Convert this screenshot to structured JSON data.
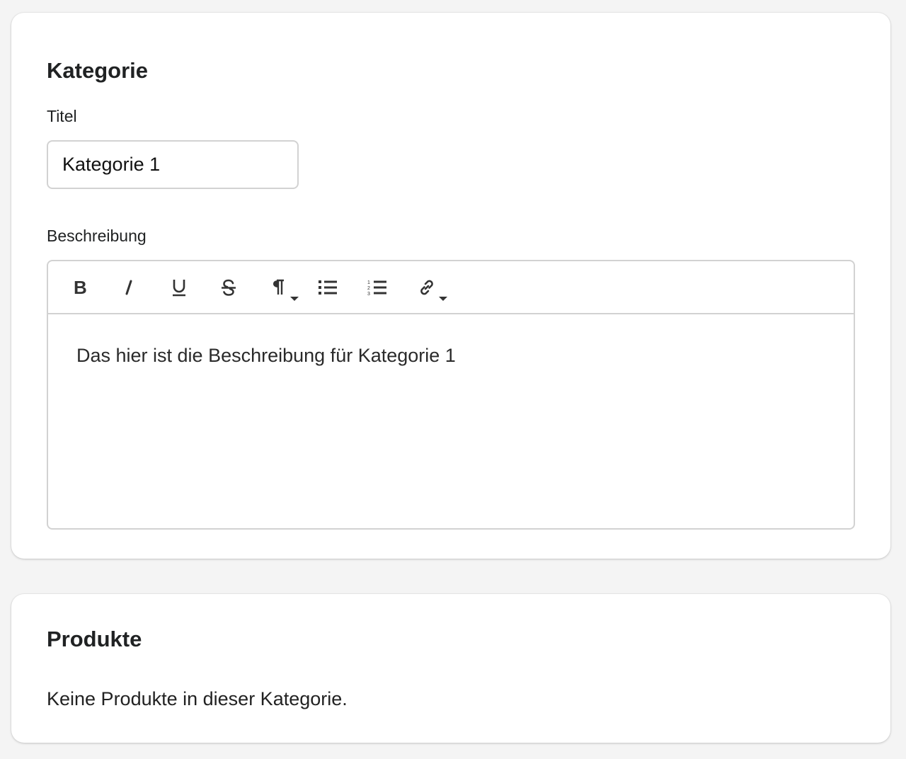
{
  "category_card": {
    "title": "Kategorie",
    "title_label": "Titel",
    "title_value": "Kategorie 1",
    "description_label": "Beschreibung",
    "description_text": "Das hier ist die Beschreibung für Kategorie 1",
    "toolbar": {
      "bold_icon": "bold-icon",
      "italic_icon": "italic-icon",
      "underline_icon": "underline-icon",
      "strikethrough_icon": "strikethrough-icon",
      "paragraph_icon": "paragraph-icon",
      "bullet_list_icon": "bullet-list-icon",
      "numbered_list_icon": "numbered-list-icon",
      "link_icon": "link-icon"
    }
  },
  "products_card": {
    "title": "Produkte",
    "empty_text": "Keine Produkte in dieser Kategorie."
  },
  "colors": {
    "background": "#f4f4f4",
    "card": "#ffffff",
    "border": "#d2d2d2",
    "text": "#202223"
  }
}
